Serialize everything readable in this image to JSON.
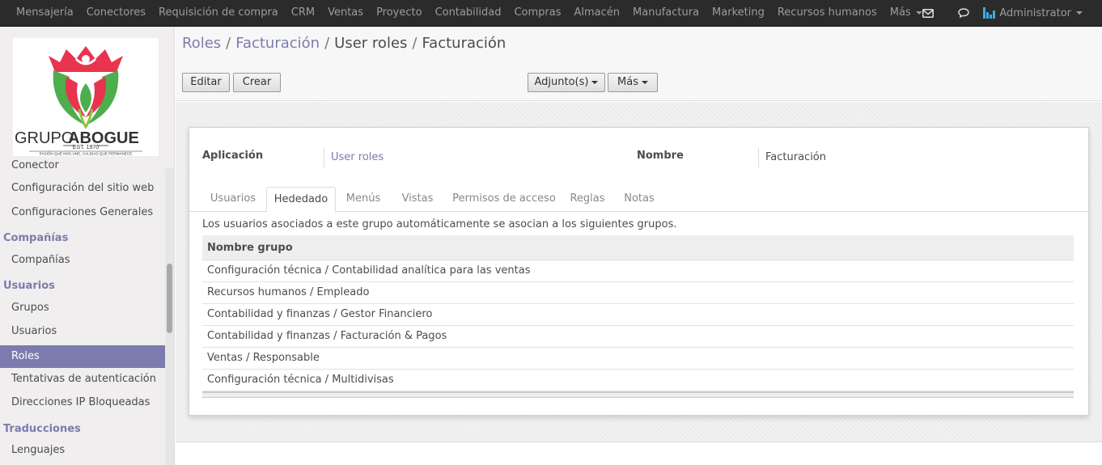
{
  "navbar": {
    "menu": [
      "Mensajería",
      "Conectores",
      "Requisición de compra",
      "CRM",
      "Ventas",
      "Proyecto",
      "Contabilidad",
      "Compras",
      "Almacén",
      "Manufactura",
      "Marketing",
      "Recursos humanos"
    ],
    "more_label": "Más",
    "icons": [
      "envelope-icon",
      "chat-icon"
    ],
    "user_name": "Administrator"
  },
  "sidebar": {
    "logo": {
      "brand_left": "GRUPO",
      "brand_right": "ABOGUE",
      "est": "EST. 1970",
      "tagline": "PASIÓN QUE NOS UNE, CALIDAD QUE PERMANECE"
    },
    "partial_item": "Conector",
    "items_top": [
      "Configuración del sitio web",
      "Configuraciones Generales"
    ],
    "sections": [
      {
        "title": "Compañías",
        "items": [
          "Compañías"
        ]
      },
      {
        "title": "Usuarios",
        "items": [
          "Grupos",
          "Usuarios",
          "Roles",
          "Tentativas de autenticación",
          "Direcciones IP Bloqueadas"
        ]
      },
      {
        "title": "Traducciones",
        "items": [
          "Lenguajes"
        ]
      }
    ],
    "active_item": "Roles"
  },
  "breadcrumb": {
    "items": [
      "Roles",
      "Facturación",
      "User roles"
    ],
    "current": "Facturación",
    "separator": "/"
  },
  "toolbar": {
    "edit_label": "Editar",
    "create_label": "Crear",
    "attachments_label": "Adjunto(s)",
    "more_label": "Más"
  },
  "form": {
    "app_label": "Aplicación",
    "app_value": "User roles",
    "name_label": "Nombre",
    "name_value": "Facturación"
  },
  "tabs": [
    {
      "label": "Usuarios",
      "active": false
    },
    {
      "label": "Hededado",
      "active": true
    },
    {
      "label": "Menús",
      "active": false
    },
    {
      "label": "Vistas",
      "active": false
    },
    {
      "label": "Permisos de acceso",
      "active": false
    },
    {
      "label": "Reglas",
      "active": false
    },
    {
      "label": "Notas",
      "active": false
    }
  ],
  "inherited": {
    "description": "Los usuarios asociados a este grupo automáticamente se asocian a los siguientes grupos.",
    "column_header": "Nombre grupo",
    "rows": [
      "Configuración técnica / Contabilidad analítica para las ventas",
      "Recursos humanos / Empleado",
      "Contabilidad y finanzas / Gestor Financiero",
      "Contabilidad y finanzas / Facturación & Pagos",
      "Ventas / Responsable",
      "Configuración técnica / Multidivisas"
    ]
  },
  "colors": {
    "brand": "#7c7bad",
    "navbar_bg": "#2b2b2b",
    "logo_red": "#e8344e",
    "logo_green": "#4cae4c"
  }
}
